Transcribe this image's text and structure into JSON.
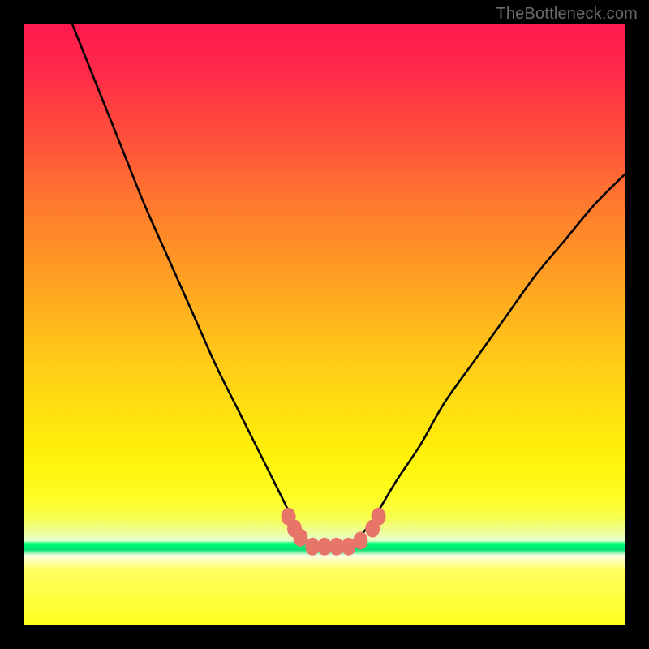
{
  "watermark": "TheBottleneck.com",
  "chart_data": {
    "type": "line",
    "title": "",
    "xlabel": "",
    "ylabel": "",
    "xlim": [
      0,
      100
    ],
    "ylim": [
      0,
      100
    ],
    "grid": false,
    "series": [
      {
        "name": "curve",
        "x": [
          8,
          12,
          16,
          20,
          24,
          28,
          32,
          36,
          40,
          43,
          45,
          47,
          49,
          51,
          53,
          55,
          57,
          59,
          62,
          66,
          70,
          75,
          80,
          85,
          90,
          95,
          100
        ],
        "y": [
          100,
          90,
          80,
          70,
          61,
          52,
          43,
          35,
          27,
          21,
          17,
          14,
          13,
          13,
          13,
          14,
          16,
          19,
          24,
          30,
          37,
          44,
          51,
          58,
          64,
          70,
          75
        ]
      }
    ],
    "markers": [
      {
        "x": 44,
        "y": 82
      },
      {
        "x": 45,
        "y": 84
      },
      {
        "x": 46,
        "y": 85.5
      },
      {
        "x": 48,
        "y": 87
      },
      {
        "x": 50,
        "y": 87
      },
      {
        "x": 52,
        "y": 87
      },
      {
        "x": 54,
        "y": 87
      },
      {
        "x": 56,
        "y": 86
      },
      {
        "x": 58,
        "y": 84
      },
      {
        "x": 59,
        "y": 82
      }
    ],
    "gradient_stops": [
      {
        "pos": 0,
        "color": "#ff1a4d"
      },
      {
        "pos": 14,
        "color": "#ff4040"
      },
      {
        "pos": 30,
        "color": "#ff7a2e"
      },
      {
        "pos": 50,
        "color": "#ffb81c"
      },
      {
        "pos": 72,
        "color": "#fff208"
      },
      {
        "pos": 86.5,
        "color": "#00ff7a"
      },
      {
        "pos": 100,
        "color": "#ffff20"
      }
    ],
    "marker_color": "#e8756a"
  }
}
